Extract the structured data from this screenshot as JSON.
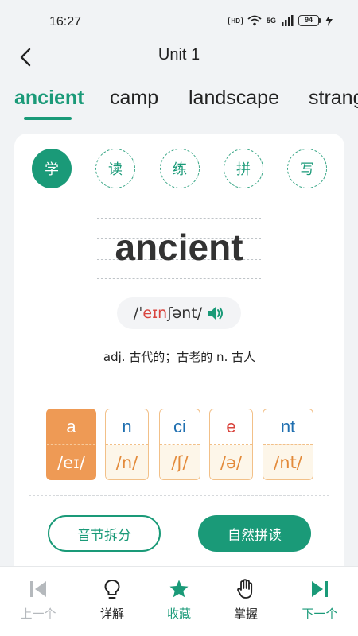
{
  "status_bar": {
    "time": "16:27",
    "hd": "HD",
    "network": "5G",
    "battery": "94"
  },
  "header": {
    "title": "Unit 1"
  },
  "word_tabs": [
    {
      "label": "ancient",
      "active": true
    },
    {
      "label": "camp",
      "active": false
    },
    {
      "label": "landscape",
      "active": false
    },
    {
      "label": "strang",
      "active": false
    }
  ],
  "steps": [
    {
      "label": "学",
      "active": true
    },
    {
      "label": "读",
      "active": false
    },
    {
      "label": "练",
      "active": false
    },
    {
      "label": "拼",
      "active": false
    },
    {
      "label": "写",
      "active": false
    }
  ],
  "word": {
    "text": "ancient",
    "phonetic_pre": "/ˈ",
    "phonetic_accent": "eɪn",
    "phonetic_post": "ʃənt/",
    "definition": "adj. 古代的；古老的 n. 古人"
  },
  "syllables": [
    {
      "letters": "a",
      "sound": "/eɪ/",
      "active": true
    },
    {
      "letters": "n",
      "sound": "/n/",
      "active": false
    },
    {
      "letters": "ci",
      "sound": "/ʃ/",
      "active": false
    },
    {
      "letters": "e",
      "sound": "/ə/",
      "active": false
    },
    {
      "letters": "nt",
      "sound": "/nt/",
      "active": false
    }
  ],
  "actions": {
    "syllable_split": "音节拆分",
    "phonics_read": "自然拼读"
  },
  "bottom_nav": {
    "prev": "上一个",
    "detail": "详解",
    "favorite": "收藏",
    "master": "掌握",
    "next": "下一个"
  },
  "colors": {
    "accent": "#1a9a78",
    "syllable_active": "#ee9a55",
    "stress": "#d9453e"
  }
}
